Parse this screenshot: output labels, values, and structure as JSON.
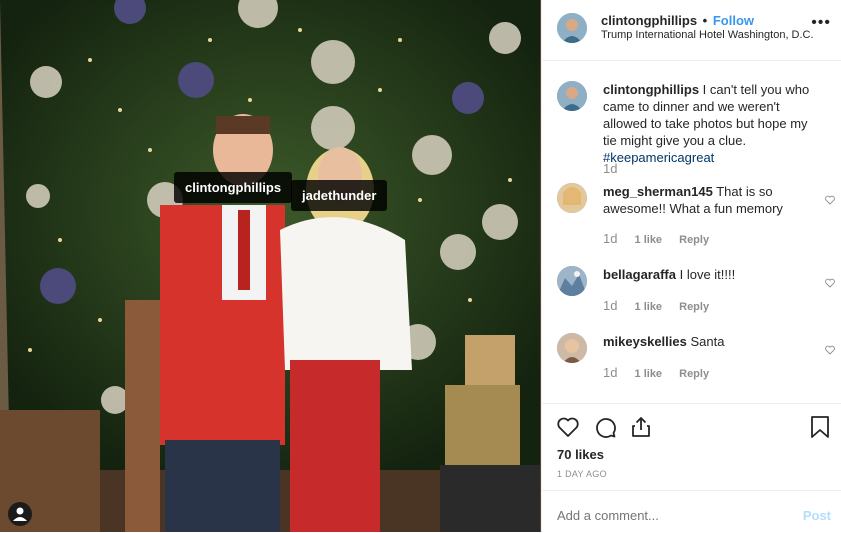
{
  "post": {
    "tags": [
      "clintongphillips",
      "jadethunder"
    ]
  },
  "header": {
    "username": "clintongphillips",
    "separator": "•",
    "follow_label": "Follow",
    "location": "Trump International Hotel Washington, D.C.",
    "more_label": "•••"
  },
  "caption": {
    "username": "clintongphillips",
    "text": "I can't tell you who came to dinner and we weren't allowed to take photos but hope my tie might give you a clue.",
    "hashtag": "#keepamericagreat",
    "age": "1d"
  },
  "comments": [
    {
      "username": "meg_sherman145",
      "text": "That is so awesome!! What a fun memory",
      "age": "1d",
      "likes": "1 like",
      "reply": "Reply"
    },
    {
      "username": "bellagaraffa",
      "text": "I love it!!!!",
      "age": "1d",
      "likes": "1 like",
      "reply": "Reply"
    },
    {
      "username": "mikeyskellies",
      "text": "Santa",
      "age": "1d",
      "likes": "1 like",
      "reply": "Reply"
    }
  ],
  "stats": {
    "likes": "70 likes",
    "posted": "1 DAY AGO"
  },
  "composer": {
    "placeholder": "Add a comment...",
    "post_label": "Post"
  }
}
